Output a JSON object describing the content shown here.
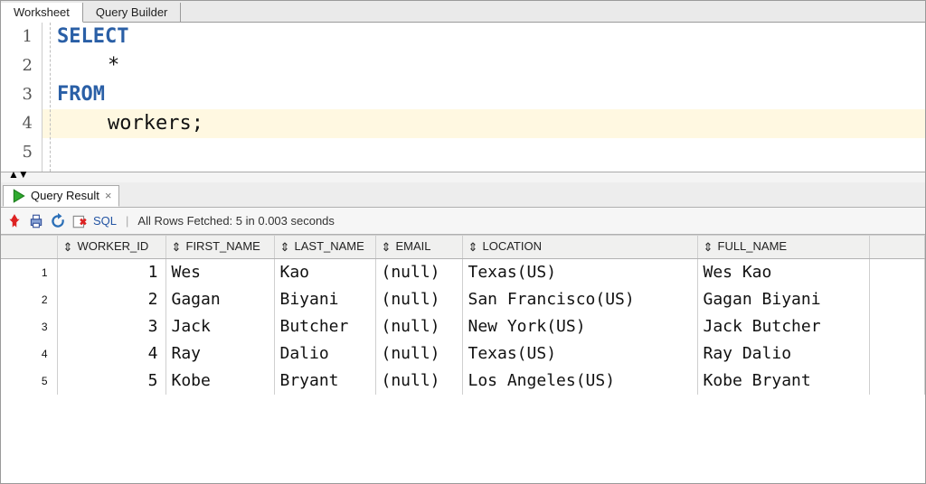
{
  "tabs": {
    "worksheet": "Worksheet",
    "builder": "Query Builder"
  },
  "editor": {
    "lines": [
      "1",
      "2",
      "3",
      "4",
      "5"
    ],
    "kw_select": "SELECT",
    "star": "*",
    "kw_from": "FROM",
    "tbl": "workers;"
  },
  "result_tab": {
    "label": "Query Result",
    "close": "×"
  },
  "toolbar": {
    "sql": "SQL",
    "sep": "|",
    "status": "All Rows Fetched: 5 in 0.003 seconds"
  },
  "columns": [
    "WORKER_ID",
    "FIRST_NAME",
    "LAST_NAME",
    "EMAIL",
    "LOCATION",
    "FULL_NAME"
  ],
  "rows": [
    {
      "n": "1",
      "id": "1",
      "first": "Wes",
      "last": "Kao",
      "email": "(null)",
      "loc": "Texas(US)",
      "full": "Wes Kao"
    },
    {
      "n": "2",
      "id": "2",
      "first": "Gagan",
      "last": "Biyani",
      "email": "(null)",
      "loc": "San Francisco(US)",
      "full": "Gagan Biyani"
    },
    {
      "n": "3",
      "id": "3",
      "first": "Jack",
      "last": "Butcher",
      "email": "(null)",
      "loc": "New York(US)",
      "full": "Jack Butcher"
    },
    {
      "n": "4",
      "id": "4",
      "first": "Ray",
      "last": "Dalio",
      "email": "(null)",
      "loc": "Texas(US)",
      "full": "Ray Dalio"
    },
    {
      "n": "5",
      "id": "5",
      "first": "Kobe",
      "last": "Bryant",
      "email": "(null)",
      "loc": "Los Angeles(US)",
      "full": "Kobe Bryant"
    }
  ]
}
